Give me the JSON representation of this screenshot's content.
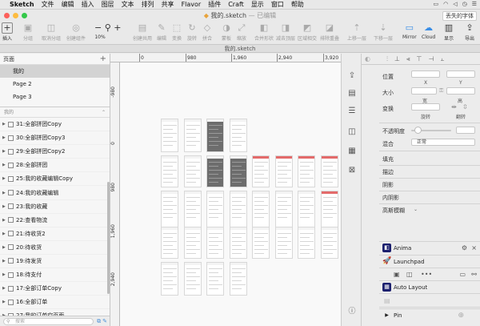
{
  "menubar": {
    "apple": "",
    "items": [
      "Sketch",
      "文件",
      "编辑",
      "插入",
      "图层",
      "文本",
      "排列",
      "共享",
      "Flavor",
      "插件",
      "Craft",
      "显示",
      "窗口",
      "帮助"
    ]
  },
  "window": {
    "title": "我的.sketch",
    "title_suffix": "— 已编辑",
    "missing_fonts_button": "丢失的字体"
  },
  "toolbar": {
    "insert": "插入",
    "group": "分组",
    "ungroup": "取消分组",
    "create_symbol": "创建组件",
    "zoom_value": "10%",
    "create_shared": "创建共用",
    "edit": "编辑",
    "transform": "变换",
    "rotate": "旋转",
    "flatten": "拼合",
    "mask": "蒙板",
    "scale": "缩放",
    "union": "合并形状",
    "subtract": "减去顶层",
    "intersect": "区域相交",
    "difference": "排除重叠",
    "forward": "上移一层",
    "backward": "下移一层",
    "mirror": "Mirror",
    "cloud": "Cloud",
    "view": "显示",
    "export": "导出"
  },
  "tab": {
    "label": "我的.sketch"
  },
  "pages": {
    "header": "页面",
    "items": [
      "我的",
      "Page 2",
      "Page 3"
    ],
    "selected": "我的"
  },
  "layers": {
    "header": "我的",
    "items": [
      "31:全部拼团Copy",
      "30:全部拼团Copy3",
      "29:全部拼团Copy2",
      "28:全部拼团",
      "25:我的收藏编辑Copy",
      "24:我的收藏编辑",
      "23:我的收藏",
      "22:查看物流",
      "21:待收货2",
      "20:待收货",
      "19:待发货",
      "18:待支付",
      "17:全部订单Copy",
      "16:全部订单",
      "27:我的订单空页面"
    ]
  },
  "search": {
    "placeholder": "搜索"
  },
  "ruler": {
    "top": [
      "0",
      "980",
      "1,960",
      "2,940",
      "3,920"
    ],
    "left": [
      "-980",
      "0",
      "980",
      "1,960",
      "2,940"
    ]
  },
  "inspector": {
    "position": "位置",
    "x": "X",
    "y": "Y",
    "size": "大小",
    "width": "宽",
    "height": "高",
    "transform": "变换",
    "rotate": "旋转",
    "flip": "翻转",
    "opacity": "不透明度",
    "blending": "混合",
    "blend_mode": "正常",
    "fills": "填充",
    "borders": "描边",
    "shadows": "阴影",
    "inner_shadows": "内阴影",
    "gaussian_blur": "高斯模糊"
  },
  "plugins": {
    "anima": "Anima",
    "launchpad": "Launchpad",
    "auto_layout": "Auto Layout",
    "pin": "Pin"
  },
  "colors": {
    "accent": "#3a8ee6",
    "red": "#e36b6b",
    "selection": "#d3d3d3"
  }
}
